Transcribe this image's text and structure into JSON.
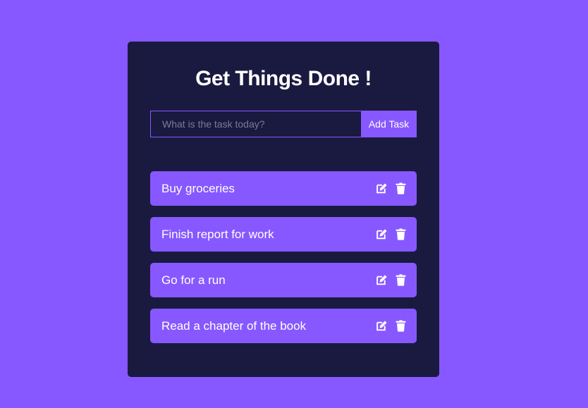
{
  "header": {
    "title": "Get Things Done !"
  },
  "form": {
    "input_placeholder": "What is the task today?",
    "add_button_label": "Add Task"
  },
  "todos": [
    {
      "text": "Buy groceries"
    },
    {
      "text": "Finish report for work"
    },
    {
      "text": "Go for a run"
    },
    {
      "text": "Read a chapter of the book"
    }
  ],
  "icons": {
    "edit": "edit-icon",
    "delete": "trash-icon"
  },
  "colors": {
    "background": "#8758ff",
    "card": "#1a1a40",
    "accent": "#8758ff",
    "text": "#ffffff"
  }
}
